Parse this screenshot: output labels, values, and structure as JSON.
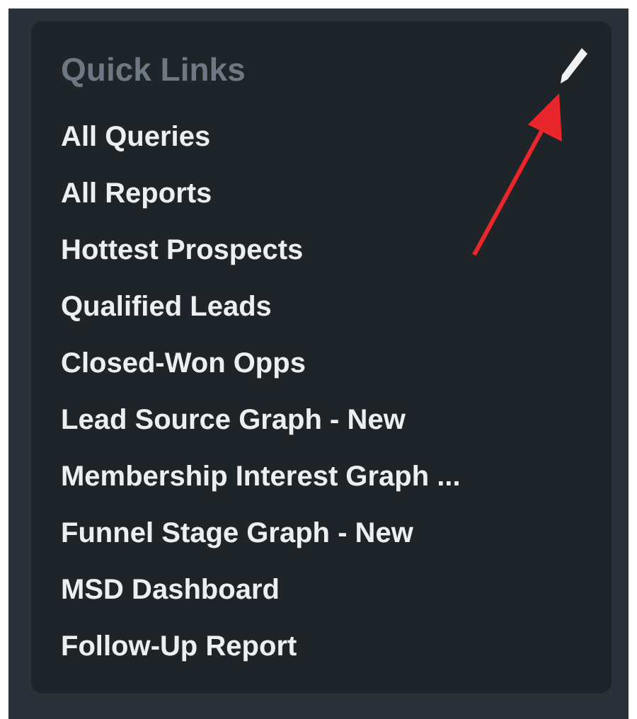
{
  "quick_links": {
    "title": "Quick Links",
    "links": [
      "All Queries",
      "All Reports",
      "Hottest Prospects",
      "Qualified Leads",
      "Closed-Won Opps",
      "Lead Source Graph - New",
      "Membership Interest Graph ...",
      "Funnel Stage Graph - New",
      "MSD Dashboard",
      "Follow-Up Report"
    ]
  }
}
